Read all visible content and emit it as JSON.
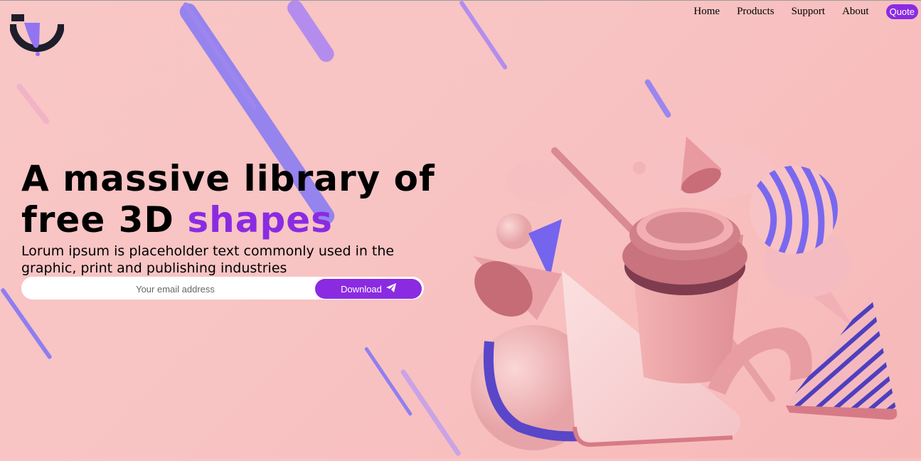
{
  "nav": {
    "items": [
      {
        "label": "Home"
      },
      {
        "label": "Products"
      },
      {
        "label": "Support"
      },
      {
        "label": "About"
      }
    ],
    "cta_label": "Quote"
  },
  "hero": {
    "title_line1": "A massive library of",
    "title_line2_start": "free 3D ",
    "title_line2_accent": "shapes",
    "subtitle": "Lorum ipsum is placeholder text commonly used in the graphic, print and publishing industries",
    "email_placeholder": "Your email address",
    "download_label": "Download"
  },
  "icons": {
    "logo": "brand-logo-icon",
    "download": "paper-plane-icon"
  },
  "colors": {
    "accent": "#8a2be2",
    "background": "#f9c6c6",
    "streak": "#8f7cf0"
  }
}
